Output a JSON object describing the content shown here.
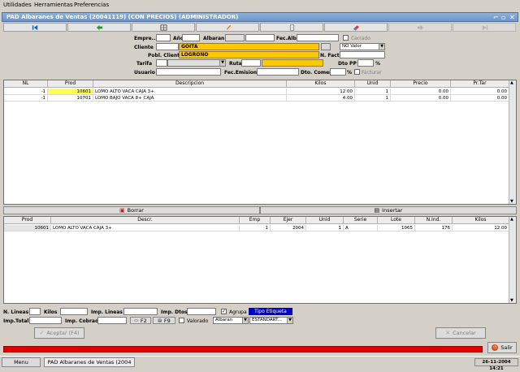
{
  "menu": {
    "items": [
      "Utilidades",
      "Herramientas",
      "Preferencias"
    ]
  },
  "window": {
    "title": "PAD Albaranes de Ventas (20041119) (CON PRECIOS)  (ADMINISTRADOR)"
  },
  "toolbar": {
    "icons": [
      "first-icon",
      "back-icon",
      "calculator-icon",
      "edit-icon",
      "document-icon",
      "eraser-icon",
      "next-icon",
      "last-icon"
    ]
  },
  "header": {
    "empresa_label": "Empre...",
    "ano_label": "Año",
    "albaran_label": "Albaran",
    "fec_alb_label": "Fec.Alb",
    "cerrado_label": "Cerrado",
    "cliente_label": "Cliente",
    "cliente_value": "GOITA",
    "valor_select": "NO Valor",
    "pobl_label": "Pobl. Cliente",
    "pobl_value": "LOGROÑO",
    "nfact_label": "N. Fact",
    "tarifa_label": "Tarifa",
    "ruta_label": "Ruta",
    "dto_pp_label": "Dto PP",
    "dto_pp_unit": "%",
    "usuario_label": "Usuario",
    "fec_emision_label": "Fec.Emision",
    "dto_comercial_label": "Dto. Comercial",
    "dto_comercial_unit": "%",
    "facturar_label": "Facturar"
  },
  "lines_table": {
    "columns": [
      "NL",
      "Prod",
      "Descripcion",
      "Kilos",
      "Unid",
      "Precio",
      "Pr.Tar"
    ],
    "rows": [
      {
        "nl": "-1",
        "prod": "10601",
        "desc": "LOMO ALTO VACA CAJA 3+",
        "kilos": "12.00",
        "unid": "1",
        "precio": "0.00",
        "prtar": "0.00"
      },
      {
        "nl": "-1",
        "prod": "10701",
        "desc": "LOMO BAJO VACA 8+ CAJA",
        "kilos": "4.00",
        "unid": "1",
        "precio": "0.00",
        "prtar": "0.00"
      }
    ]
  },
  "actions": {
    "borrar": "Borrar",
    "insertar": "Insertar"
  },
  "detail_table": {
    "columns": [
      "Prod",
      "Descr.",
      "Emp",
      "Ejer",
      "Unid",
      "Serie",
      "Lote",
      "N.Ind.",
      "Kilos"
    ],
    "rows": [
      {
        "prod": "10601",
        "descr": "LOMO ALTO VACA CAJA 3+",
        "emp": "1",
        "ejer": "2004",
        "unid": "1",
        "serie": "A",
        "lote": "1065",
        "nind": "176",
        "kilos": "12.00"
      }
    ]
  },
  "footer": {
    "n_lineas_label": "N. Lineas",
    "kilos_label": "Kilos",
    "imp_lineas_label": "Imp. Lineas",
    "imp_dtos_label": "Imp. Dtos",
    "agrupa_label": "Agrupa",
    "tipo_etiqueta": "Tipo Etiqueta",
    "imp_total_label": "Imp.Total",
    "imp_cobrado_label": "Imp. Cobrado",
    "f2_label": "F2",
    "f9_label": "F9",
    "valorado_label": "Valorado",
    "albaran_select": "Albaran",
    "estandart_select": "ESTANDART...",
    "aceptar_label": "Aceptar (F4)",
    "cancelar_label": "Cancelar",
    "salir_label": "Salir"
  },
  "taskbar": {
    "menu_label": "Menu",
    "task_label": "PAD Albaranes de Ventas (2004",
    "clock": "26-11-2004  14:21"
  },
  "colors": {
    "highlight": "#ffc800",
    "progress": "#e00000",
    "title": "#6d95c8",
    "tipo": "#0000c8"
  }
}
